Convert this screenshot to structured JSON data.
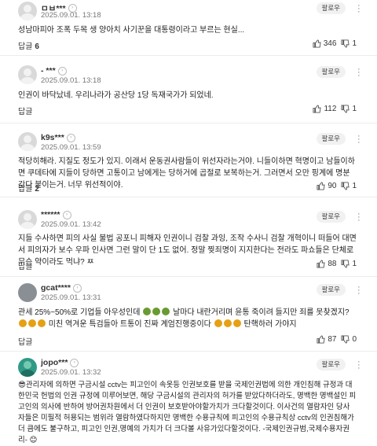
{
  "labels": {
    "follow": "팔로우",
    "reply": "답글",
    "more": "⋮"
  },
  "comments": [
    {
      "nickname": "ㅁㅂ***",
      "date": "2025.09.01. 13:18",
      "text": "성남마피아 조폭 두목 생 양아치 사기꾼을 대통령이라고 부르는 현실...",
      "reply_count": "6",
      "likes": "346",
      "dislikes": "1"
    },
    {
      "nickname": "- ***",
      "date": "2025.09.01. 13:18",
      "text": "인권이 바닥났네. 우리나라가 공산당 1당 독재국가가 되었네.",
      "reply_count": "",
      "likes": "112",
      "dislikes": "1"
    },
    {
      "nickname": "k9s***",
      "date": "2025.09.01. 13:59",
      "text": "적당히해라. 지질도 정도가 있지. 이래서 운동권사람들이 위선자라는거야. 니들이하면 혁명이고 남들이하면 쿠데타에 지들이 당하면 고통이고 남에게는 당하거에 곱절로 보복하는거. 그러면서 오만 핑계에 명분 갖다 붙이는거. 너무 위선적이야.",
      "reply_count": "2",
      "likes": "90",
      "dislikes": "1"
    },
    {
      "nickname": "******",
      "date": "2025.09.01. 13:42",
      "text": "지들 수사하면 피의 사실 불법 공포니 피해자 인권이니 검찰 과잉, 조작 수사니 검찰 개혁이니 떠들어 대면서 피의자가 보수 우파 인사면 그런 말이 단 1도 없어. 정말 찢죄명이 지지한다는 전라도 파쇼들은 단체로 무슨 약이라도 먹냐? ㅉ",
      "reply_count": "",
      "likes": "88",
      "dislikes": "1"
    },
    {
      "nickname": "gcat****",
      "date": "2025.09.01. 13:31",
      "text_a": "관세 25%~50%로 기업들 아우성인데",
      "text_b": "날마다 내란거리며 윤통 죽이려 들지만 죄를 못찾겠지?",
      "text_c": "미친 역겨운 특검들아 트통이 진짜 계엄진행중이다",
      "text_d": "탄핵하러 가야지",
      "reply_count": "",
      "likes": "87",
      "dislikes": "0"
    },
    {
      "nickname": "jopo***",
      "date": "2025.09.01. 13:32",
      "text": "😎관리자에 의하면 구금시설 cctv는 피고인이 속옷등 인권보호를 받을 국제인권법에 의한 개인침해 규정과 대한민국 헌법의 인권 규정에 미루어보면, 해당 구금시설의 관리자의 허가를 받았다하더라도, 명백한 명백설인 피고인의 의사에 반하여 방어권차원에서 더 인권이 보호받아야할가치가 크다할것이다. 이사건의 열람자인 당사자들은 미필적 허용되는 범위라 열람하였다하지만 명백한 수용규칙에 피고인의 수용규칙상 cctv의 인권침해가 더 큼에도 불구하고, 피고인 인권,명예의 가치가 더 크다볼 사유가있다할것이다. -국제인권규범,국제수용자권리- 😊",
      "reply_count": "",
      "likes": "",
      "dislikes": ""
    }
  ]
}
